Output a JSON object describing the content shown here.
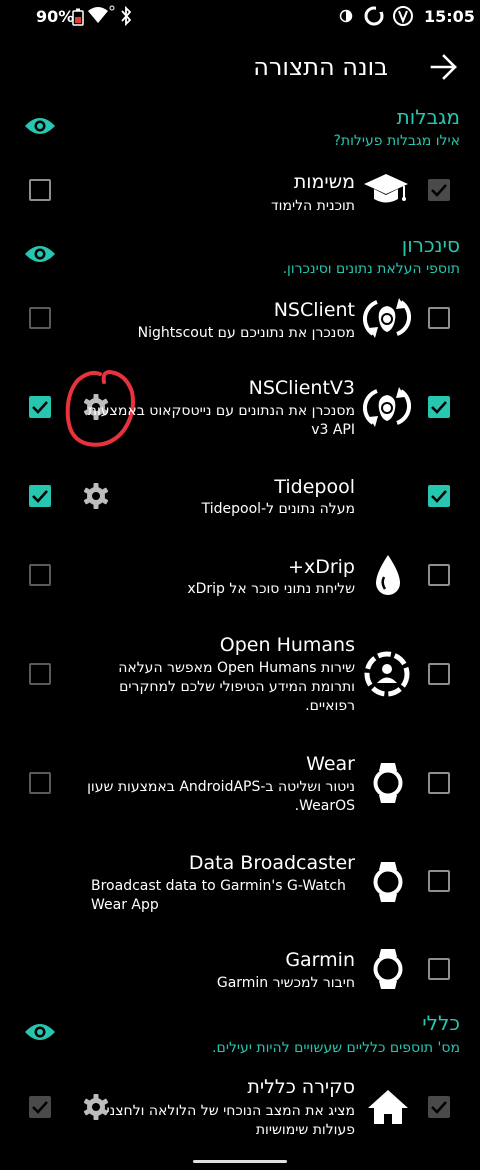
{
  "status_bar": {
    "battery": "90%",
    "time": "15:05"
  },
  "app_bar": {
    "title": "בונה התצורה"
  },
  "sections": [
    {
      "title": "מגבלות",
      "subtitle": "אילו מגבלות פעילות?",
      "items": [
        {
          "title": "משימות",
          "desc": "תוכנית הלימוד",
          "enabled": true,
          "visible": false,
          "icon": "graduation-cap-icon"
        }
      ]
    },
    {
      "title": "סינכרון",
      "subtitle": "תוספי העלאת נתונים וסינכרון.",
      "items": [
        {
          "title": "NSClient",
          "desc": "מסנכרן את נתוניכם עם Nightscout",
          "enabled": false,
          "visible": false,
          "icon": "nightscout-sync-icon"
        },
        {
          "title": "NSClientV3",
          "desc": "מסנכרן את הנתונים עם נייטסקאוט באמצעות v3 API",
          "enabled": true,
          "visible": true,
          "icon": "nightscout-sync-icon",
          "settings": true
        },
        {
          "title": "Tidepool",
          "desc": "מעלה נתונים ל-Tidepool",
          "enabled": true,
          "visible": true,
          "icon": "",
          "settings": true
        },
        {
          "title": "xDrip+",
          "desc": "שליחת נתוני סוכר אל xDrip",
          "enabled": false,
          "visible": false,
          "icon": "drop-icon"
        },
        {
          "title": "Open Humans",
          "desc": "שירות Open Humans מאפשר העלאה ותרומת המידע הטיפולי שלכם למחקרים רפואיים.",
          "enabled": false,
          "visible": false,
          "icon": "open-humans-icon"
        },
        {
          "title": "Wear",
          "desc": "ניטור ושליטה ב-AndroidAPS באמצעות שעון WearOS.",
          "enabled": false,
          "visible": false,
          "icon": "watch-icon"
        },
        {
          "title": "Data Broadcaster",
          "desc": "Broadcast data to Garmin's G-Watch Wear App",
          "enabled": false,
          "visible": false,
          "icon": "watch-icon"
        },
        {
          "title": "Garmin",
          "desc": "חיבור למכשיר Garmin",
          "enabled": false,
          "visible": false,
          "icon": "watch-icon"
        }
      ]
    },
    {
      "title": "כללי",
      "subtitle": "מס' תוספים כלליים שעשויים להיות יעילים.",
      "items": [
        {
          "title": "סקירה כללית",
          "desc": "מציג את המצב הנוכחי של הלולאה ולחצני פעולות שימושיות",
          "enabled": true,
          "visible": true,
          "icon": "home-icon",
          "settings": true
        }
      ]
    }
  ],
  "colors": {
    "accent": "#26c6b0",
    "background": "#000000",
    "annotation": "#e8323c"
  }
}
